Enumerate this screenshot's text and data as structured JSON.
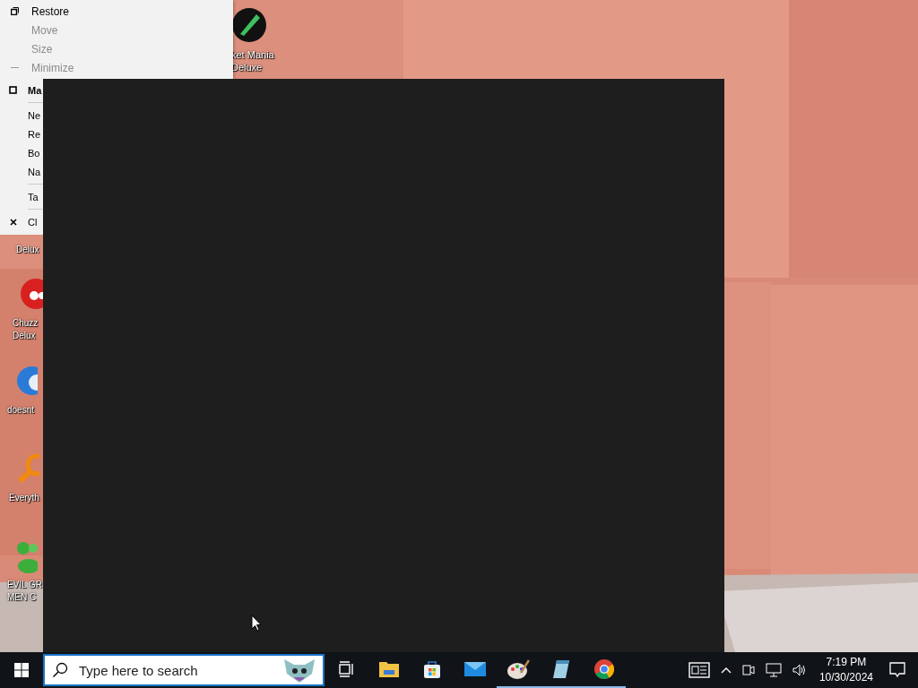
{
  "desktop_icons": [
    {
      "kind": "rocket",
      "lines": [
        "ket Mania",
        "Deluxe"
      ]
    },
    {
      "kind": "blank",
      "lines": [
        "Delux"
      ]
    },
    {
      "kind": "red",
      "lines": [
        "Chuzz",
        "Delux"
      ]
    },
    {
      "kind": "bird",
      "lines": [
        "doesnt"
      ]
    },
    {
      "kind": "search",
      "lines": [
        "Everyth"
      ]
    },
    {
      "kind": "people",
      "lines": [
        "EVIL GR",
        "MEN C"
      ]
    }
  ],
  "system_menu": {
    "items": [
      {
        "kind": "item",
        "label": "Restore",
        "disabled": false,
        "bold": false
      },
      {
        "kind": "item",
        "label": "Move",
        "disabled": true,
        "bold": false
      },
      {
        "kind": "item",
        "label": "Size",
        "disabled": true,
        "bold": false
      },
      {
        "kind": "item",
        "label": "Minimize",
        "disabled": true,
        "bold": false
      },
      {
        "kind": "item",
        "label": "Ma",
        "disabled": false,
        "bold": true
      },
      {
        "kind": "separator"
      },
      {
        "kind": "item",
        "label": "Ne",
        "disabled": false,
        "bold": false
      },
      {
        "kind": "item",
        "label": "Re",
        "disabled": false,
        "bold": false
      },
      {
        "kind": "item",
        "label": "Bo",
        "disabled": false,
        "bold": false
      },
      {
        "kind": "item",
        "label": "Na",
        "disabled": false,
        "bold": false
      },
      {
        "kind": "separator"
      },
      {
        "kind": "item",
        "label": "Ta",
        "disabled": false,
        "bold": false
      },
      {
        "kind": "separator"
      },
      {
        "kind": "item",
        "label": "Cl",
        "disabled": false,
        "bold": false
      }
    ]
  },
  "taskbar": {
    "search": {
      "placeholder": "Type here to search"
    },
    "apps": [
      {
        "kind": "taskview",
        "running": false
      },
      {
        "kind": "folder",
        "running": false
      },
      {
        "kind": "store",
        "running": false
      },
      {
        "kind": "mail",
        "running": false
      },
      {
        "kind": "paint",
        "running": true
      },
      {
        "kind": "notepad",
        "running": true
      },
      {
        "kind": "chrome",
        "running": true
      }
    ],
    "clock": {
      "time": "7:19 PM",
      "date": "10/30/2024"
    }
  }
}
